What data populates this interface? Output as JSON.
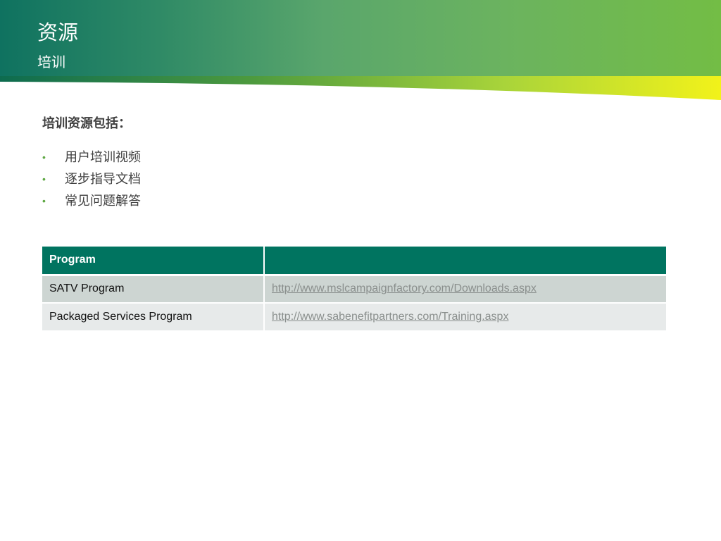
{
  "header": {
    "title": "资源",
    "subtitle": "培训"
  },
  "intro": "培训资源包括：",
  "bullets": [
    "用户培训视频",
    "逐步指导文档",
    "常见问题解答"
  ],
  "table": {
    "headers": [
      "Program",
      ""
    ],
    "rows": [
      {
        "program": "SATV Program",
        "url": "http://www.mslcampaignfactory.com/Downloads.aspx"
      },
      {
        "program": "Packaged Services Program",
        "url": "http://www.sabenefitpartners.com/Training.aspx"
      }
    ]
  },
  "colors": {
    "header_start": "#0f7260",
    "header_end": "#73bd45",
    "table_header": "#007460",
    "row_1": "#cdd5d2",
    "row_2": "#e7eaea",
    "bullet": "#5fa844"
  }
}
